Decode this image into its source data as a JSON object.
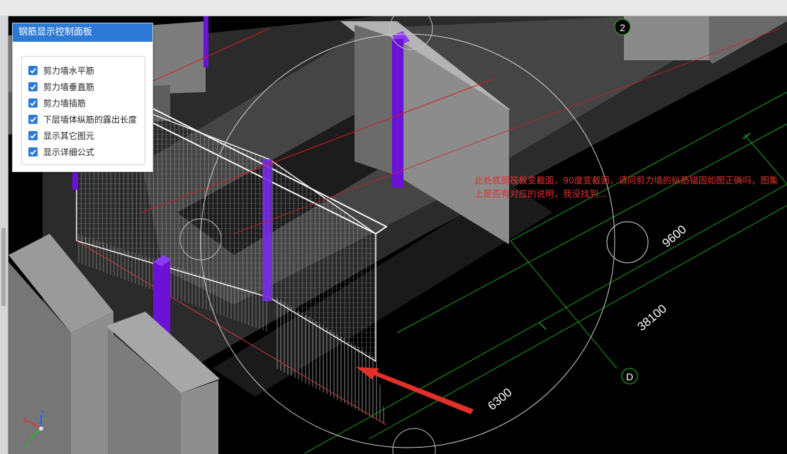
{
  "panel": {
    "title": "钢筋显示控制面板",
    "options": [
      {
        "label": "剪力墙水平筋",
        "checked": true
      },
      {
        "label": "剪力墙垂直筋",
        "checked": true
      },
      {
        "label": "剪力墙插筋",
        "checked": true
      },
      {
        "label": "下层墙体纵筋的露出长度",
        "checked": true
      },
      {
        "label": "显示其它图元",
        "checked": true
      },
      {
        "label": "显示详细公式",
        "checked": true
      }
    ]
  },
  "annotation": {
    "text": "此处底部筏板变截面，90度变截面，请问剪力墙的纵筋锚固如图正确吗，图集上是否有对应的说明，我没找到...",
    "color": "#e0312f"
  },
  "grid_labels": {
    "axis_2": "2",
    "axis_D": "D"
  },
  "dimensions": {
    "d1": "9600",
    "d2": "38100",
    "d3": "6300"
  },
  "colors": {
    "column": "#6a12d6",
    "grid_line": "#1fa21f",
    "axis_red": "#d21e1e",
    "wall_gray": "#8d8d8d",
    "panel_header": "#2d7ad6"
  }
}
